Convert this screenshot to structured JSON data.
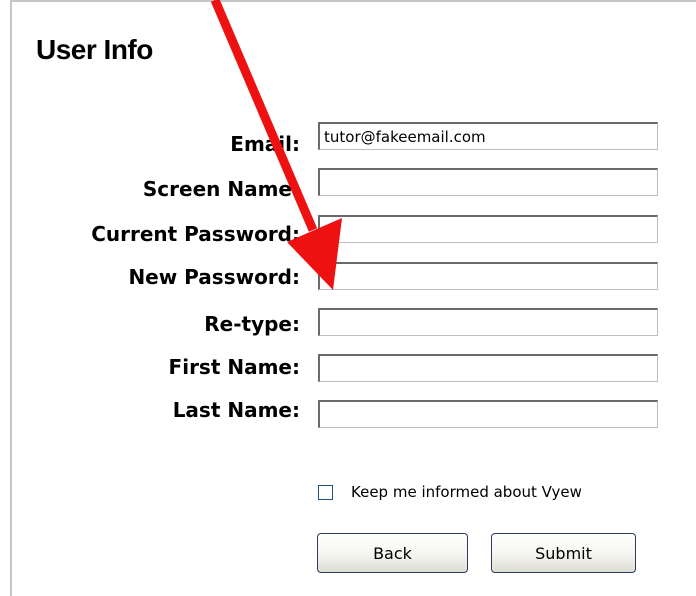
{
  "section": {
    "title": "User Info"
  },
  "form": {
    "email": {
      "label": "Email:",
      "value": "tutor@fakeemail.com"
    },
    "screen_name": {
      "label": "Screen Name:",
      "value": ""
    },
    "current_password": {
      "label": "Current Password:",
      "value": ""
    },
    "new_password": {
      "label": "New Password:",
      "value": ""
    },
    "retype": {
      "label": "Re-type:",
      "value": ""
    },
    "first_name": {
      "label": "First Name:",
      "value": ""
    },
    "last_name": {
      "label": "Last Name:",
      "value": ""
    }
  },
  "newsletter": {
    "label": "Keep me informed about Vyew",
    "checked": false
  },
  "buttons": {
    "back": "Back",
    "submit": "Submit"
  },
  "annotation": {
    "arrow_color": "#ee1111"
  }
}
